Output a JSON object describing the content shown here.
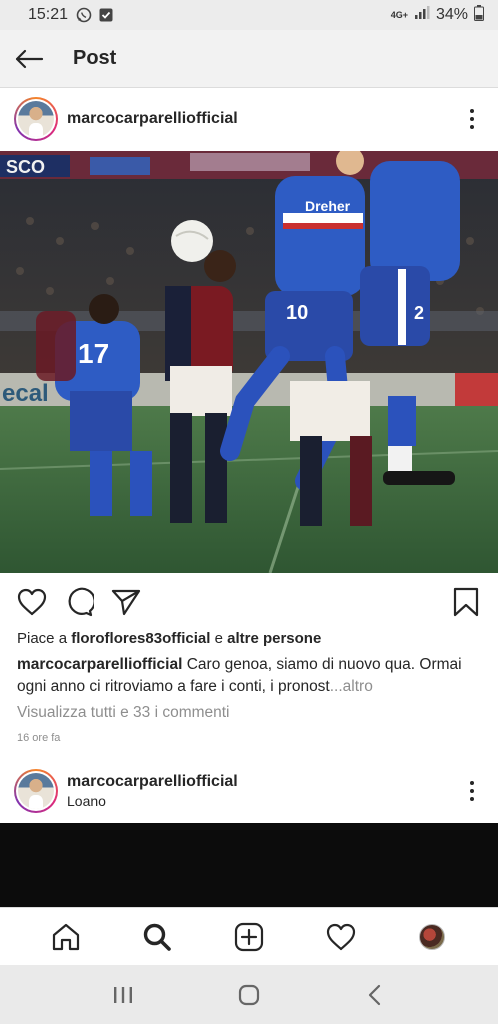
{
  "status_bar": {
    "time": "15:21",
    "network": "4G+",
    "battery": "34%"
  },
  "header": {
    "title": "Post"
  },
  "post": {
    "username": "marcocarparelliofficial",
    "likes_prefix": "Piace a",
    "liked_by": "floroflores83official",
    "likes_connector": "e",
    "likes_others": "altre persone",
    "caption_author": "marcocarparelliofficial",
    "caption_text": "Caro genoa, siamo di nuovo qua. Ormai ogni anno ci ritroviamo a fare i conti, i pronost",
    "caption_more": "...altro",
    "view_comments": "Visualizza tutti e 33 i commenti",
    "time_ago": "16 ore fa"
  },
  "next_post": {
    "username": "marcocarparelliofficial",
    "location": "Loano"
  },
  "photo": {
    "banner_left": "SCO",
    "ad_board_left": "ecal",
    "player_1_number": "17",
    "player_2_number": "10",
    "player_3_number": "2",
    "sponsor": "Dreher"
  },
  "icons": {
    "back": "arrow-left-icon",
    "more": "more-vertical-icon",
    "like": "heart-icon",
    "comment": "comment-icon",
    "share": "send-icon",
    "save": "bookmark-icon",
    "home": "home-icon",
    "search": "search-icon",
    "add": "add-post-icon",
    "activity": "heart-icon",
    "profile": "profile-avatar-icon"
  },
  "colors": {
    "accent_text": "#262626",
    "muted_text": "#8e8e8e"
  }
}
